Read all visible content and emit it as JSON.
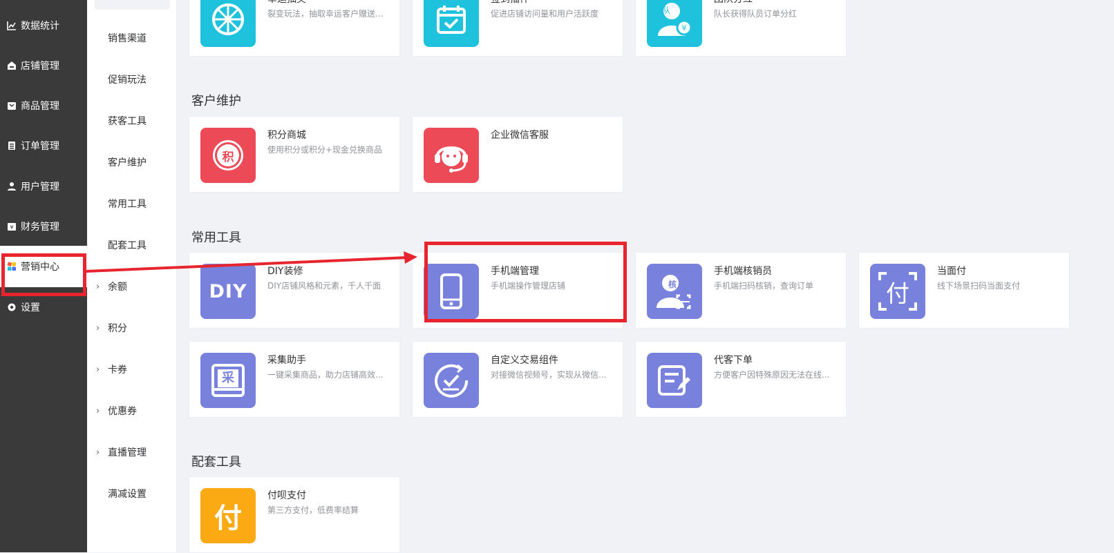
{
  "sidebar": {
    "items": [
      {
        "label": "数据统计",
        "icon": "chart-line-icon"
      },
      {
        "label": "店铺管理",
        "icon": "shop-icon"
      },
      {
        "label": "商品管理",
        "icon": "goods-icon"
      },
      {
        "label": "订单管理",
        "icon": "order-icon"
      },
      {
        "label": "用户管理",
        "icon": "user-icon"
      },
      {
        "label": "财务管理",
        "icon": "finance-icon"
      },
      {
        "label": "营销中心",
        "icon": "marketing-icon"
      },
      {
        "label": "设置",
        "icon": "gear-icon"
      }
    ]
  },
  "subnav": {
    "items": [
      {
        "label": "销售渠道"
      },
      {
        "label": "促销玩法"
      },
      {
        "label": "获客工具"
      },
      {
        "label": "客户维护"
      },
      {
        "label": "常用工具"
      },
      {
        "label": "配套工具"
      },
      {
        "label": "余额",
        "chevron": "›"
      },
      {
        "label": "积分",
        "chevron": "›"
      },
      {
        "label": "卡券",
        "chevron": "›"
      },
      {
        "label": "优惠券",
        "chevron": "›"
      },
      {
        "label": "直播管理",
        "chevron": "›"
      },
      {
        "label": "满减设置"
      }
    ]
  },
  "sections": {
    "top": {
      "cards": [
        {
          "title": "幸运抽奖",
          "desc": "裂变玩法，抽取幸运客户赠送...",
          "icon": "wheel-icon"
        },
        {
          "title": "签到插件",
          "desc": "促进店铺访问量和用户活跃度",
          "icon": "calendar-check-icon"
        },
        {
          "title": "团队分红",
          "desc": "队长获得队员订单分红",
          "icon": "team-bonus-icon",
          "badge": "队"
        }
      ]
    },
    "customer": {
      "title": "客户维护",
      "cards": [
        {
          "title": "积分商城",
          "desc": "使用积分或积分+现金兑换商品",
          "icon": "points-mall-icon",
          "badge": "积"
        },
        {
          "title": "企业微信客服",
          "desc": "",
          "icon": "customer-service-icon"
        }
      ]
    },
    "common": {
      "title": "常用工具",
      "cards": [
        {
          "title": "DIY装修",
          "desc": "DIY店铺风格和元素，千人千面",
          "icon": "diy-icon",
          "badge": "DIY"
        },
        {
          "title": "手机端管理",
          "desc": "手机端操作管理店铺",
          "icon": "mobile-phone-icon"
        },
        {
          "title": "手机端核销员",
          "desc": "手机端扫码核销，查询订单",
          "icon": "verifier-icon",
          "badge": "核"
        },
        {
          "title": "当面付",
          "desc": "线下场景扫码当面支付",
          "icon": "face-pay-icon",
          "badge": "付"
        },
        {
          "title": "采集助手",
          "desc": "一键采集商品，助力店铺高效...",
          "icon": "collect-icon",
          "badge": "采"
        },
        {
          "title": "自定义交易组件",
          "desc": "对接微信视频号，实现从微信...",
          "icon": "trade-component-icon"
        },
        {
          "title": "代客下单",
          "desc": "方便客户因特殊原因无法在线...",
          "icon": "proxy-order-icon"
        }
      ]
    },
    "support": {
      "title": "配套工具",
      "cards": [
        {
          "title": "付呗支付",
          "desc": "第三方支付，低费率结算",
          "icon": "fubei-pay-icon",
          "badge": "付"
        }
      ]
    }
  },
  "colors": {
    "sidebar_bg": "#3a3a3a",
    "cyan": "#1ec2dc",
    "red": "#ec4a57",
    "purple": "#7882dc",
    "yellow": "#fbaa14",
    "highlight": "#e8252f"
  }
}
